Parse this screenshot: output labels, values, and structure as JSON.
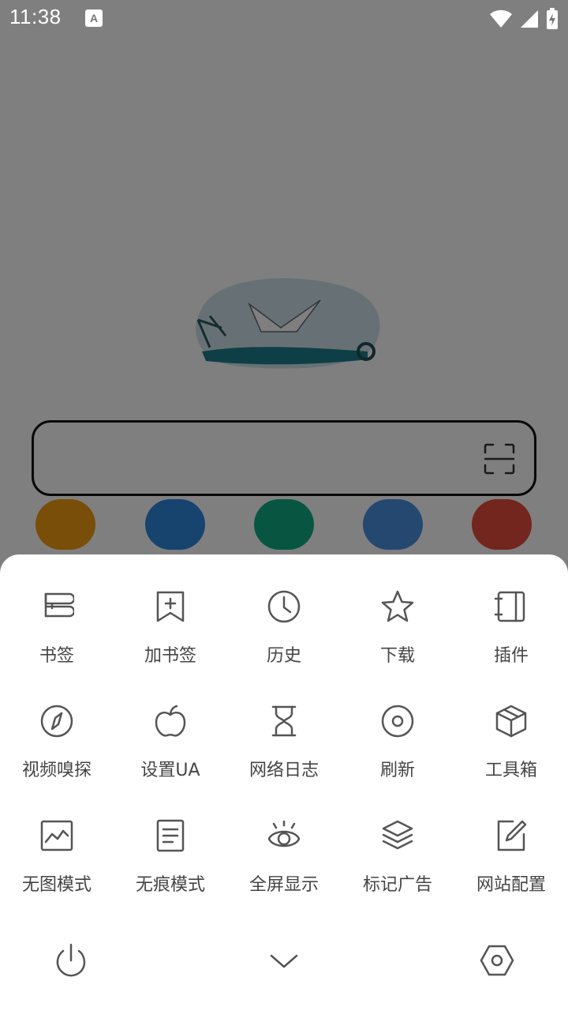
{
  "status_bar": {
    "time": "11:38",
    "notification_icon": "a-letter-icon",
    "wifi_icon": "wifi-icon",
    "signal_icon": "signal-icon",
    "battery_icon": "battery-charging-icon"
  },
  "home": {
    "logo_icon": "seagull-logo-icon",
    "search_placeholder": "",
    "scan_icon": "scan-icon",
    "shortcut_colors": [
      "#f39c12",
      "#2e86de",
      "#10ac84",
      "#4a90e2",
      "#e74c3c"
    ]
  },
  "menu": {
    "rows": [
      [
        {
          "label": "书签",
          "icon": "bookmarks-icon"
        },
        {
          "label": "加书签",
          "icon": "add-bookmark-icon"
        },
        {
          "label": "历史",
          "icon": "clock-icon"
        },
        {
          "label": "下载",
          "icon": "star-icon"
        },
        {
          "label": "插件",
          "icon": "plugin-icon"
        }
      ],
      [
        {
          "label": "视频嗅探",
          "icon": "compass-icon"
        },
        {
          "label": "设置UA",
          "icon": "apple-icon"
        },
        {
          "label": "网络日志",
          "icon": "hourglass-icon"
        },
        {
          "label": "刷新",
          "icon": "refresh-circle-icon"
        },
        {
          "label": "工具箱",
          "icon": "box-icon"
        }
      ],
      [
        {
          "label": "无图模式",
          "icon": "image-chart-icon"
        },
        {
          "label": "无痕模式",
          "icon": "document-icon"
        },
        {
          "label": "全屏显示",
          "icon": "eye-icon"
        },
        {
          "label": "标记广告",
          "icon": "layers-icon"
        },
        {
          "label": "网站配置",
          "icon": "edit-icon"
        }
      ]
    ],
    "bottom": {
      "power_icon": "power-icon",
      "collapse_icon": "chevron-down-icon",
      "settings_icon": "hexagon-settings-icon"
    }
  },
  "colors": {
    "overlay": "rgba(0,0,0,0.5)",
    "icon_stroke": "#555555",
    "label": "#444444"
  }
}
